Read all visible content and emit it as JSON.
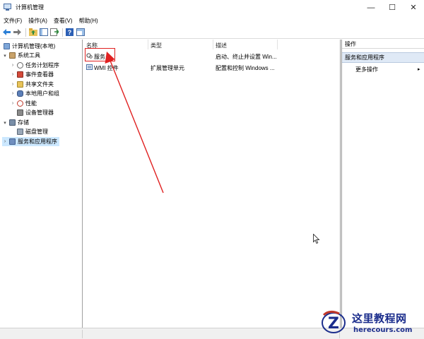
{
  "window": {
    "title": "计算机管理",
    "minimize_glyph": "—",
    "maximize_glyph": "☐",
    "close_glyph": "✕"
  },
  "menu": [
    "文件(F)",
    "操作(A)",
    "查看(V)",
    "帮助(H)"
  ],
  "toolbar": [
    "back-arrow-icon",
    "forward-arrow-icon",
    "up-folder-icon",
    "show-hide-tree-icon",
    "export-list-icon",
    "help-icon",
    "show-hide-action-icon"
  ],
  "tree": {
    "items": [
      {
        "label": "计算机管理(本地)",
        "level": 0,
        "expander": "",
        "icon": "computer-management-icon"
      },
      {
        "label": "系统工具",
        "level": 0,
        "expander": "▾",
        "icon": "system-tools-icon"
      },
      {
        "label": "任务计划程序",
        "level": 1,
        "expander": "›",
        "icon": "task-scheduler-icon"
      },
      {
        "label": "事件查看器",
        "level": 1,
        "expander": "›",
        "icon": "event-viewer-icon"
      },
      {
        "label": "共享文件夹",
        "level": 1,
        "expander": "›",
        "icon": "shared-folders-icon"
      },
      {
        "label": "本地用户和组",
        "level": 1,
        "expander": "›",
        "icon": "local-users-icon"
      },
      {
        "label": "性能",
        "level": 1,
        "expander": "›",
        "icon": "performance-icon"
      },
      {
        "label": "设备管理器",
        "level": 1,
        "expander": "",
        "icon": "device-manager-icon"
      },
      {
        "label": "存储",
        "level": 0,
        "expander": "▾",
        "icon": "storage-icon"
      },
      {
        "label": "磁盘管理",
        "level": 1,
        "expander": "",
        "icon": "disk-management-icon"
      },
      {
        "label": "服务和应用程序",
        "level": 0,
        "expander": "›",
        "icon": "services-apps-icon",
        "selected": true
      }
    ]
  },
  "list": {
    "columns": [
      "名称",
      "类型",
      "描述"
    ],
    "rows": [
      {
        "name": "服务",
        "type": "",
        "description": "启动、终止并设置 Win...",
        "icon": "services-gear-icon"
      },
      {
        "name": "WMI 控件",
        "type": "扩展管理单元",
        "description": "配置和控制 Windows ...",
        "icon": "wmi-control-icon"
      }
    ]
  },
  "actions": {
    "header": "操作",
    "section": "服务和应用程序",
    "item": "更多操作",
    "item_arrow": "▸"
  },
  "colors": {
    "accent": "#cce8ff",
    "annotation": "#e02020",
    "watermark": "#1b2d8c"
  },
  "watermark": {
    "name": "这里教程网",
    "url": "herecours.com"
  }
}
